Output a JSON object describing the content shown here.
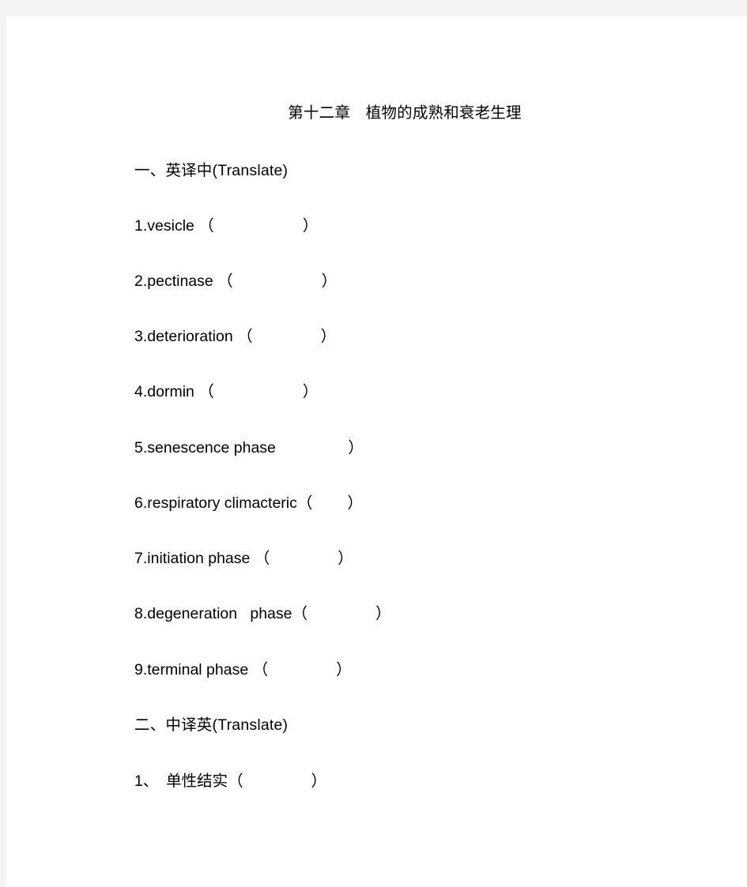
{
  "document": {
    "title": "第十二章　植物的成熟和衰老生理",
    "sections": [
      {
        "heading": "一、英译中(Translate)",
        "items": [
          {
            "number": "1.",
            "term": "vesicle",
            "open_paren": "（",
            "close_paren": "）"
          },
          {
            "number": "2.",
            "term": "pectinase",
            "open_paren": "（",
            "close_paren": "）"
          },
          {
            "number": "3.",
            "term": "deterioration",
            "open_paren": "（",
            "close_paren": "）"
          },
          {
            "number": "4.",
            "term": "dormin",
            "open_paren": "（",
            "close_paren": "）"
          },
          {
            "number": "5.",
            "term": "senescence phase",
            "open_paren": "",
            "close_paren": "）"
          },
          {
            "number": "6.",
            "term": "respiratory climacteric",
            "open_paren": "（",
            "close_paren": "）"
          },
          {
            "number": "7.",
            "term": "initiation phase",
            "open_paren": "（",
            "close_paren": "）"
          },
          {
            "number": "8.",
            "term": "degeneration   phase",
            "open_paren": "（",
            "close_paren": "）"
          },
          {
            "number": "9.",
            "term": "terminal phase",
            "open_paren": "（",
            "close_paren": "）"
          }
        ]
      },
      {
        "heading": "二、中译英(Translate)",
        "items": [
          {
            "number": "1、",
            "term": "单性结实",
            "open_paren": "（",
            "close_paren": "）"
          }
        ]
      }
    ]
  },
  "lines": {
    "l1": "1.vesicle （",
    "l2": "2.pectinase （",
    "l3": "3.deterioration （",
    "l4": "4.dormin （",
    "l5": "5.senescence phase ",
    "l6": "6.respiratory climacteric（",
    "l7": "7.initiation phase （",
    "l8": "8.degeneration   phase（",
    "l9": "9.terminal phase （",
    "l10": "1、　单性结实（",
    "close": "）",
    "head1": "一、英译中(Translate)",
    "head2": "二、中译英(Translate)"
  }
}
